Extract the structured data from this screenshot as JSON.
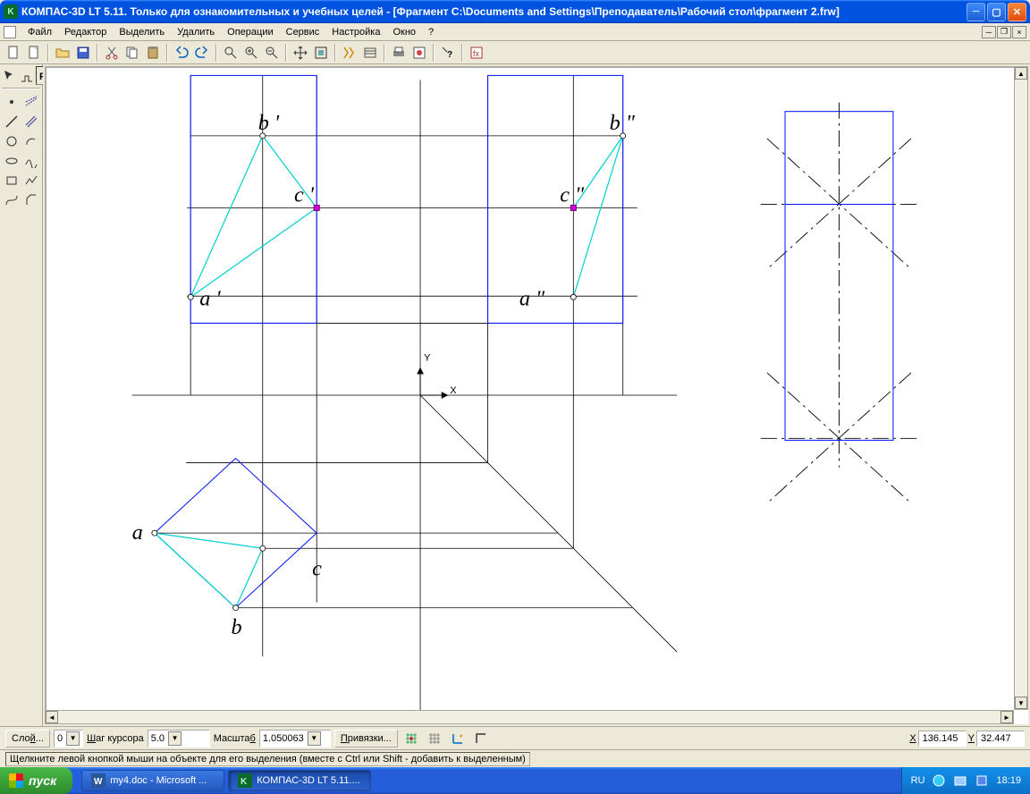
{
  "title": "КОМПАС-3D LT 5.11. Только для ознакомительных и учебных целей - [Фрагмент C:\\Documents and Settings\\Преподаватель\\Рабочий стол\\фрагмент 2.frw]",
  "menu": [
    "Файл",
    "Редактор",
    "Выделить",
    "Удалить",
    "Операции",
    "Сервис",
    "Настройка",
    "Окно",
    "?"
  ],
  "status": {
    "layer_label": "Сло<u>й</u>...",
    "layer_value": "0",
    "step_label": "<u>Ш</u>аг курсора",
    "step_value": "5.0",
    "scale_label": "Масшта<u>б</u>",
    "scale_value": "1.050063",
    "snap_label": "<u>П</u>ривязки...",
    "x_label": "X",
    "x_value": "136.145",
    "y_label": "Y",
    "y_value": "32.447",
    "hint": "Щелкните левой кнопкой мыши на объекте для его выделения (вместе с Ctrl или Shift - добавить к выделенным)"
  },
  "taskbar": {
    "start": "пуск",
    "items": [
      "my4.doc - Microsoft ...",
      "КОМПАС-3D LT 5.11...."
    ],
    "lang": "RU",
    "time": "18:19"
  },
  "canvas_labels": {
    "a": "a",
    "b": "b",
    "c": "c",
    "a1": "a '",
    "b1": "b '",
    "c1": "c '",
    "a2": "a \"",
    "b2": "b \"",
    "c2": "c \"",
    "X": "X",
    "Y": "Y"
  }
}
